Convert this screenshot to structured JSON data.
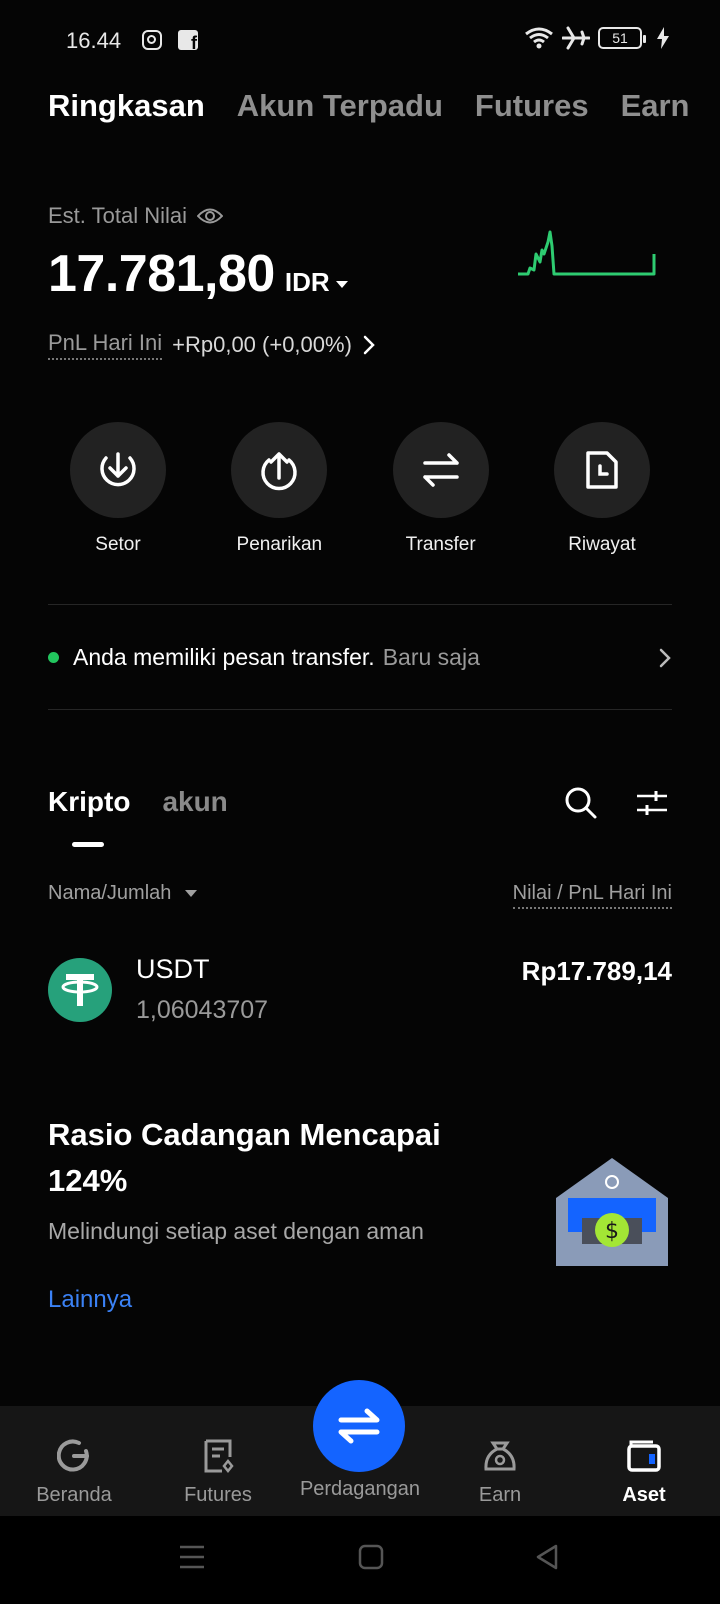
{
  "status_bar": {
    "time": "16.44",
    "battery": "51",
    "icons": [
      "instagram-icon",
      "facebook-icon",
      "wifi-icon",
      "airplane-icon",
      "battery-icon",
      "charging-icon"
    ]
  },
  "top_tabs": [
    {
      "label": "Ringkasan",
      "active": true
    },
    {
      "label": "Akun Terpadu",
      "active": false
    },
    {
      "label": "Futures",
      "active": false
    },
    {
      "label": "Earn",
      "active": false
    }
  ],
  "balance": {
    "label": "Est. Total Nilai",
    "value": "17.781,80",
    "currency": "IDR",
    "pnl_label": "PnL Hari Ini",
    "pnl_value": "+Rp0,00 (+0,00%)"
  },
  "actions": [
    {
      "label": "Setor",
      "icon": "deposit-icon"
    },
    {
      "label": "Penarikan",
      "icon": "withdraw-icon"
    },
    {
      "label": "Transfer",
      "icon": "transfer-icon"
    },
    {
      "label": "Riwayat",
      "icon": "history-icon"
    }
  ],
  "notice": {
    "text": "Anda memiliki pesan transfer.",
    "time": "Baru saja"
  },
  "assets_tabs": [
    {
      "label": "Kripto",
      "active": true
    },
    {
      "label": "akun",
      "active": false
    }
  ],
  "list_header": {
    "left": "Nama/Jumlah",
    "right": "Nilai / PnL Hari Ini"
  },
  "assets": [
    {
      "name": "USDT",
      "amount": "1,06043707",
      "value": "Rp17.789,14"
    }
  ],
  "promo": {
    "title": "Rasio Cadangan Mencapai 124%",
    "subtitle": "Melindungi setiap aset dengan aman",
    "link": "Lainnya"
  },
  "bottom_nav": [
    {
      "label": "Beranda",
      "icon": "home-icon"
    },
    {
      "label": "Futures",
      "icon": "futures-icon"
    },
    {
      "label": "Perdagangan",
      "icon": "trade-icon"
    },
    {
      "label": "Earn",
      "icon": "earn-icon"
    },
    {
      "label": "Aset",
      "icon": "wallet-icon",
      "active": true
    }
  ],
  "colors": {
    "accent_blue": "#1464ff",
    "positive_green": "#22c55e",
    "usdt_green": "#26a17b",
    "link_blue": "#3b82f6"
  }
}
